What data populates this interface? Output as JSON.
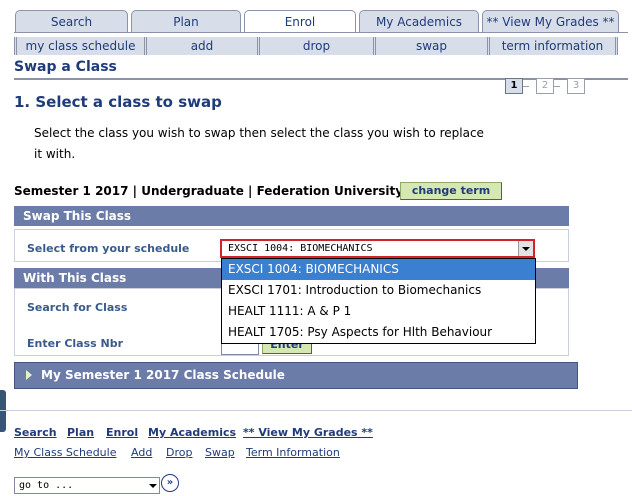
{
  "main_tabs": [
    {
      "label": "Search"
    },
    {
      "label": "Plan"
    },
    {
      "label": "Enrol",
      "active": true
    },
    {
      "label": "My Academics"
    },
    {
      "label": "** View My Grades **"
    }
  ],
  "sub_tabs": [
    {
      "label": "my class schedule"
    },
    {
      "label": "add"
    },
    {
      "label": "drop"
    },
    {
      "label": "swap",
      "active": true
    },
    {
      "label": "term information"
    }
  ],
  "page_title": "Swap a Class",
  "steps": [
    "1",
    "2",
    "3"
  ],
  "current_step": 1,
  "section_heading": "1.  Select a class to swap",
  "instructions": "Select the class you wish to swap then select the class you wish to replace it with.",
  "term_info": "Semester 1 2017 | Undergraduate | Federation University",
  "change_term_button": "change term",
  "swap_group": {
    "title": "Swap This Class",
    "select_label": "Select from your schedule",
    "selected_value": "EXSCI 1004: BIOMECHANICS",
    "options": [
      "EXSCI 1004: BIOMECHANICS",
      "EXSCI 1701: Introduction to Biomechanics",
      "HEALT 1111: A & P 1",
      "HEALT 1705: Psy Aspects for Hlth Behaviour"
    ]
  },
  "with_group": {
    "title": "With This Class",
    "search_label": "Search for Class",
    "class_nbr_label": "Enter Class Nbr",
    "enter_button": "Enter"
  },
  "schedule_collapsible": "My Semester 1 2017 Class Schedule",
  "footer_links_1": [
    "Search",
    "Plan",
    "Enrol",
    "My Academics",
    "** View My Grades **"
  ],
  "footer_links_2": [
    "My Class Schedule",
    "Add",
    "Drop",
    "Swap",
    "Term Information"
  ],
  "goto_select": "go to ...",
  "colors": {
    "accent": "#1f3b7a",
    "group_bar": "#6c7ca8",
    "highlight": "#3b80d0",
    "focus_border": "#d2232a"
  }
}
